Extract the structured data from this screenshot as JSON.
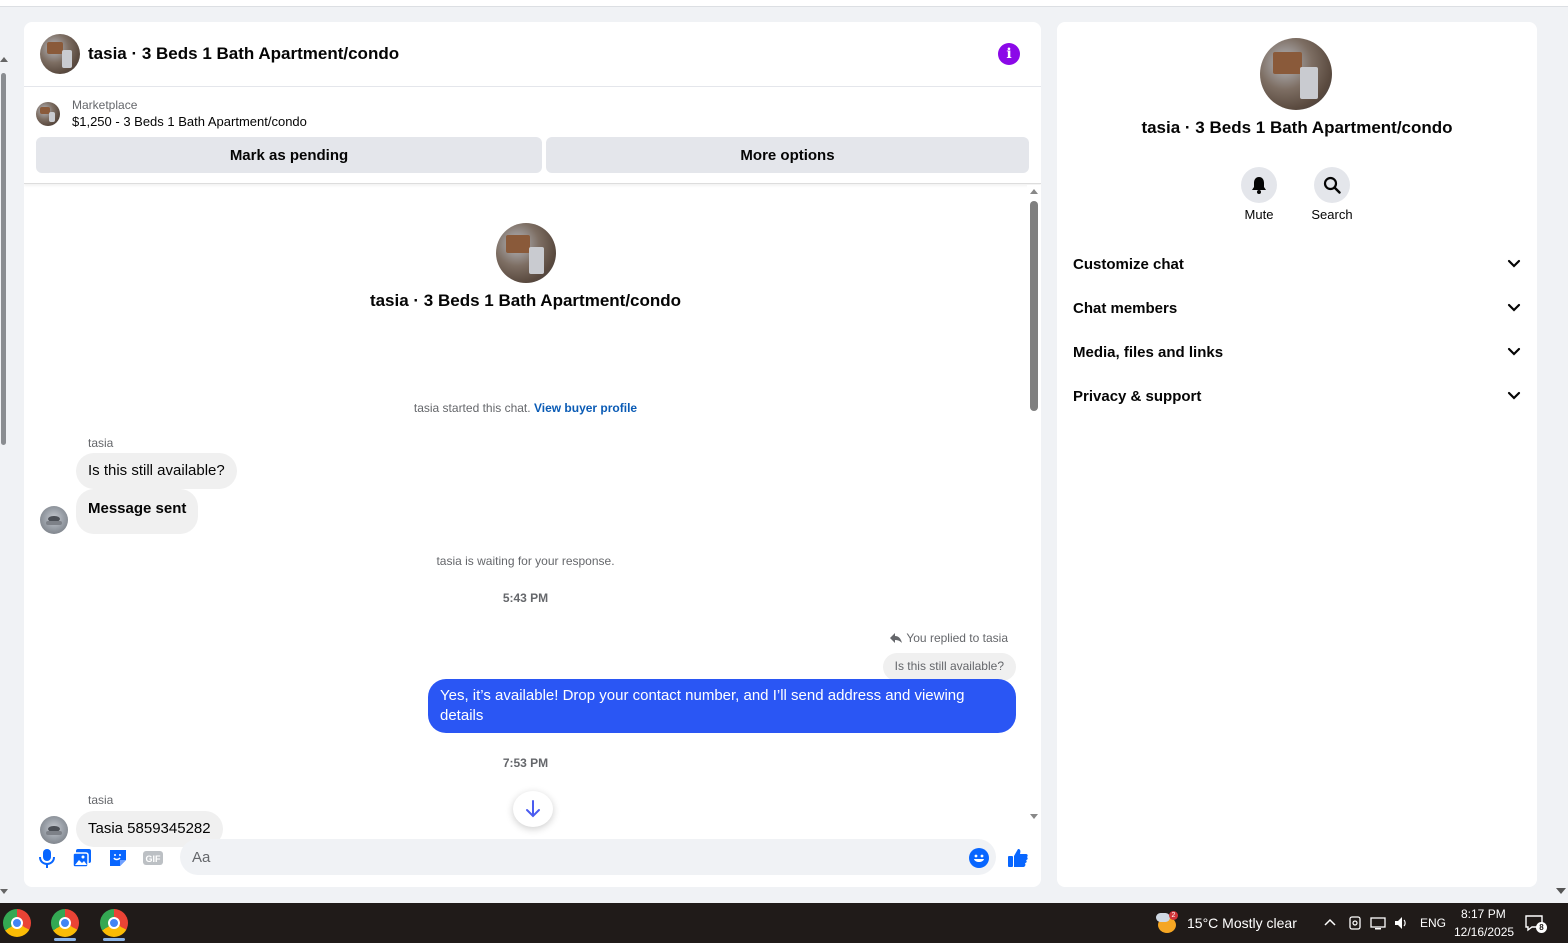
{
  "chat": {
    "title": "tasia · 3 Beds 1 Bath Apartment/condo",
    "listing": {
      "kicker": "Marketplace",
      "title": "$1,250 - 3 Beds 1 Bath Apartment/condo"
    },
    "buttons": {
      "pending": "Mark as pending",
      "more": "More options"
    },
    "intro_title": "tasia · 3 Beds 1 Bath Apartment/condo",
    "started_text": "tasia started this chat.",
    "view_profile": "View buyer profile",
    "messages": [
      {
        "sender": "tasia",
        "text": "Is this still available?"
      },
      {
        "text": "Message sent"
      }
    ],
    "waiting_text": "tasia is waiting for your response.",
    "time1": "5:43 PM",
    "reply_meta": "You replied to tasia",
    "reply_quote": "Is this still available?",
    "outgoing": "Yes, it’s available! Drop your contact number, and I’ll send address and viewing details",
    "time2": "7:53 PM",
    "last_sender": "tasia",
    "last_message": "Tasia 5859345282",
    "composer_placeholder": "Aa"
  },
  "info_panel": {
    "title": "tasia · 3 Beds 1 Bath Apartment/condo",
    "actions": [
      "Mute",
      "Search"
    ],
    "sections": [
      "Customize chat",
      "Chat members",
      "Media, files and links",
      "Privacy & support"
    ]
  },
  "taskbar": {
    "weather_badge": "2",
    "weather": "15°C  Mostly clear",
    "language": "ENG",
    "time": "8:17 PM",
    "date": "12/16/2025",
    "notifications": "8"
  },
  "colors": {
    "accent": "#2a56f4",
    "info": "#8b08e8",
    "link": "#0a5bb5",
    "icon_blue": "#0866ff"
  },
  "icons": [
    "info-icon",
    "microphone-icon",
    "photo-icon",
    "sticker-icon",
    "gif-icon",
    "emoji-icon",
    "like-icon",
    "bell-icon",
    "search-icon",
    "chevron-down-icon",
    "reply-icon",
    "arrow-down-icon"
  ]
}
